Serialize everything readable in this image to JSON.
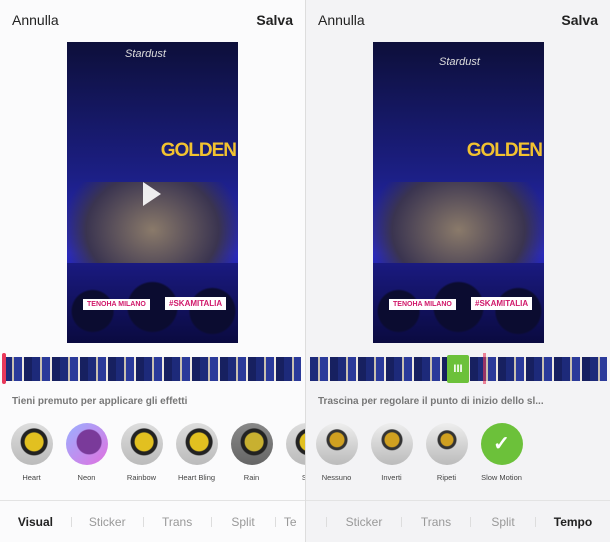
{
  "left": {
    "cancel": "Annulla",
    "save": "Salva",
    "video": {
      "banner": "GOLDEN",
      "logo": "Stardust",
      "tag_location": "TENOHA MILANO",
      "tag_hashtag": "#SKAMITALIA"
    },
    "caption": "Tieni premuto per applicare gli effetti",
    "effects": [
      {
        "label": "Heart"
      },
      {
        "label": "Neon"
      },
      {
        "label": "Rainbow"
      },
      {
        "label": "Heart Bling"
      },
      {
        "label": "Rain"
      },
      {
        "label": "Sn"
      }
    ],
    "tabs": [
      {
        "label": "Visual",
        "active": true
      },
      {
        "label": "Sticker"
      },
      {
        "label": "Trans"
      },
      {
        "label": "Split"
      },
      {
        "label": "Te"
      }
    ]
  },
  "right": {
    "cancel": "Annulla",
    "save": "Salva",
    "video": {
      "banner": "GOLDEN",
      "logo": "Stardust",
      "tag_location": "TENOHA MILANO",
      "tag_hashtag": "#SKAMITALIA"
    },
    "caption": "Trascina per regolare il punto di inizio dello sl...",
    "effects": [
      {
        "label": "Nessuno"
      },
      {
        "label": "Inverti"
      },
      {
        "label": "Ripeti"
      },
      {
        "label": "Slow Motion",
        "selected": true
      }
    ],
    "tabs": [
      {
        "label": "Sticker"
      },
      {
        "label": "Trans"
      },
      {
        "label": "Split"
      },
      {
        "label": "Tempo",
        "active": true
      }
    ]
  },
  "colors": {
    "accent_green": "#6cc13a",
    "playhead_red": "#e8385a"
  }
}
